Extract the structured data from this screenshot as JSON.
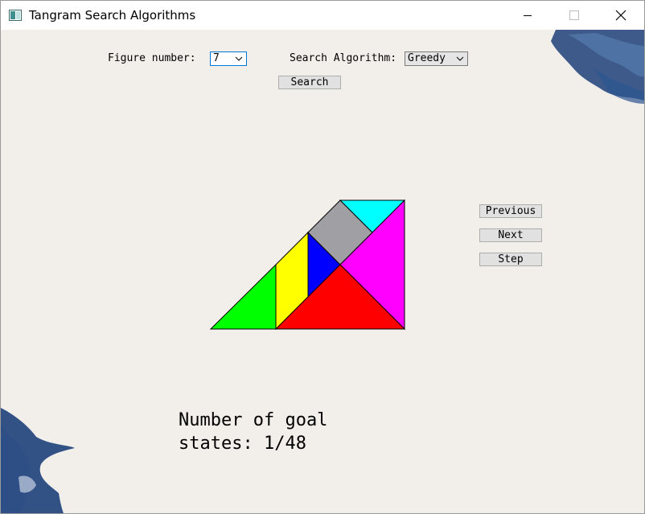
{
  "window": {
    "title": "Tangram Search Algorithms"
  },
  "controls": {
    "figure_label": "Figure number:",
    "figure_value": "7",
    "algorithm_label": "Search Algorithm:",
    "algorithm_value": "Greedy",
    "search_button": "Search"
  },
  "nav": {
    "previous": "Previous",
    "next": "Next",
    "step": "Step"
  },
  "result": {
    "line1": "Number of goal",
    "line2": "states: 1/48"
  },
  "colors": {
    "green": "#00ff00",
    "yellow": "#ffff00",
    "blue": "#0000ff",
    "gray": "#a0a0a4",
    "cyan": "#00ffff",
    "magenta": "#ff00ff",
    "red": "#ff0000",
    "focus_border": "#0078d7",
    "ink": "#1d3f7a"
  },
  "icons": [
    "app-icon",
    "minimize-icon",
    "maximize-icon",
    "close-icon",
    "chevron-down-icon"
  ]
}
